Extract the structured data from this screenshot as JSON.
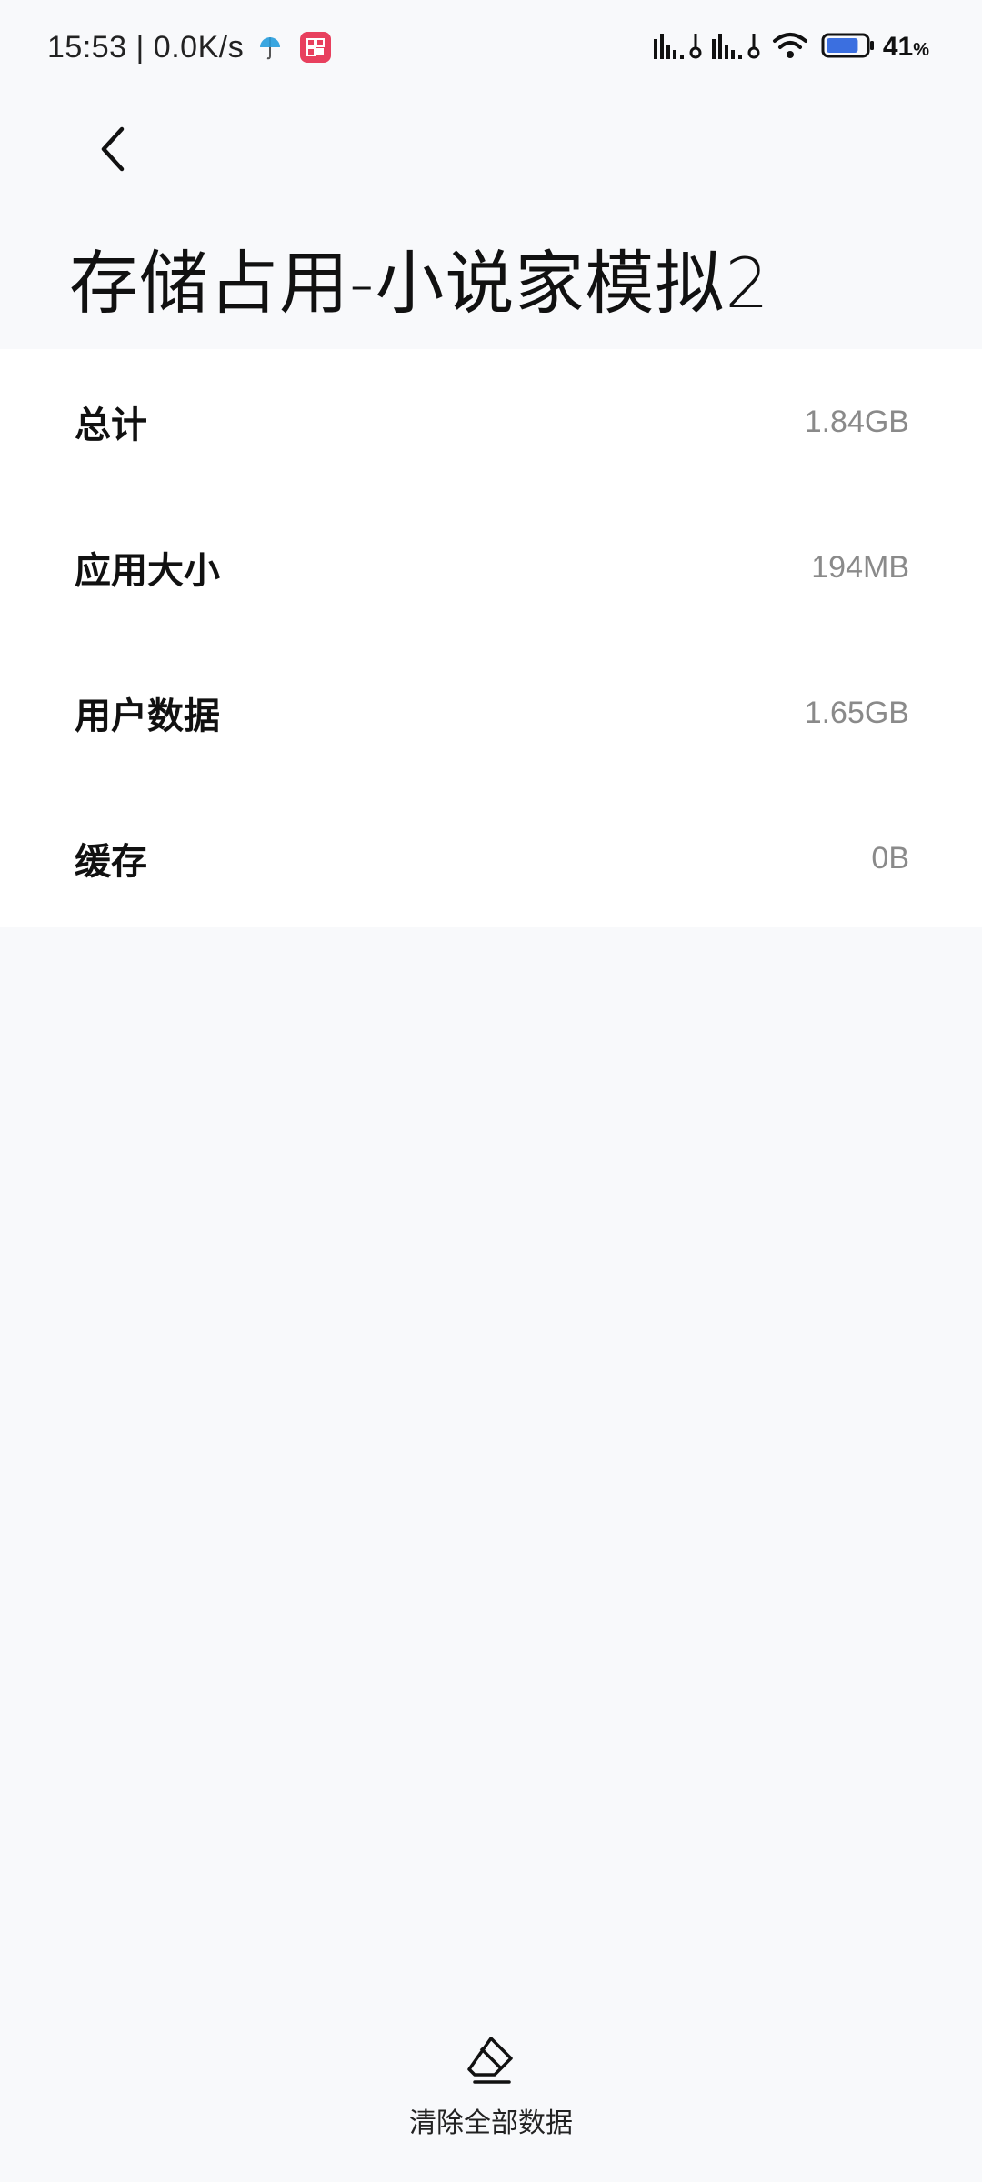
{
  "status_bar": {
    "time_speed": "15:53 | 0.0K/s",
    "battery_level": "41",
    "battery_unit": "%",
    "battery_fraction": 0.41,
    "icons": [
      "umbrella-icon",
      "app-notification-icon",
      "signal-icon",
      "signal-icon",
      "wifi-icon",
      "battery-icon"
    ]
  },
  "header": {
    "back_icon": "chevron-left-icon",
    "title": "存储占用-小说家模拟2"
  },
  "storage": {
    "rows": [
      {
        "label": "总计",
        "value": "1.84GB"
      },
      {
        "label": "应用大小",
        "value": "194MB"
      },
      {
        "label": "用户数据",
        "value": "1.65GB"
      },
      {
        "label": "缓存",
        "value": "0B"
      }
    ]
  },
  "actions": {
    "clear_all_label": "清除全部数据",
    "clear_all_icon": "eraser-icon"
  },
  "colors": {
    "background": "#f8f9fb",
    "card": "#ffffff",
    "value_text": "#8a8a8a",
    "battery_fill": "#3b6fe0",
    "badge": "#e8405e"
  }
}
